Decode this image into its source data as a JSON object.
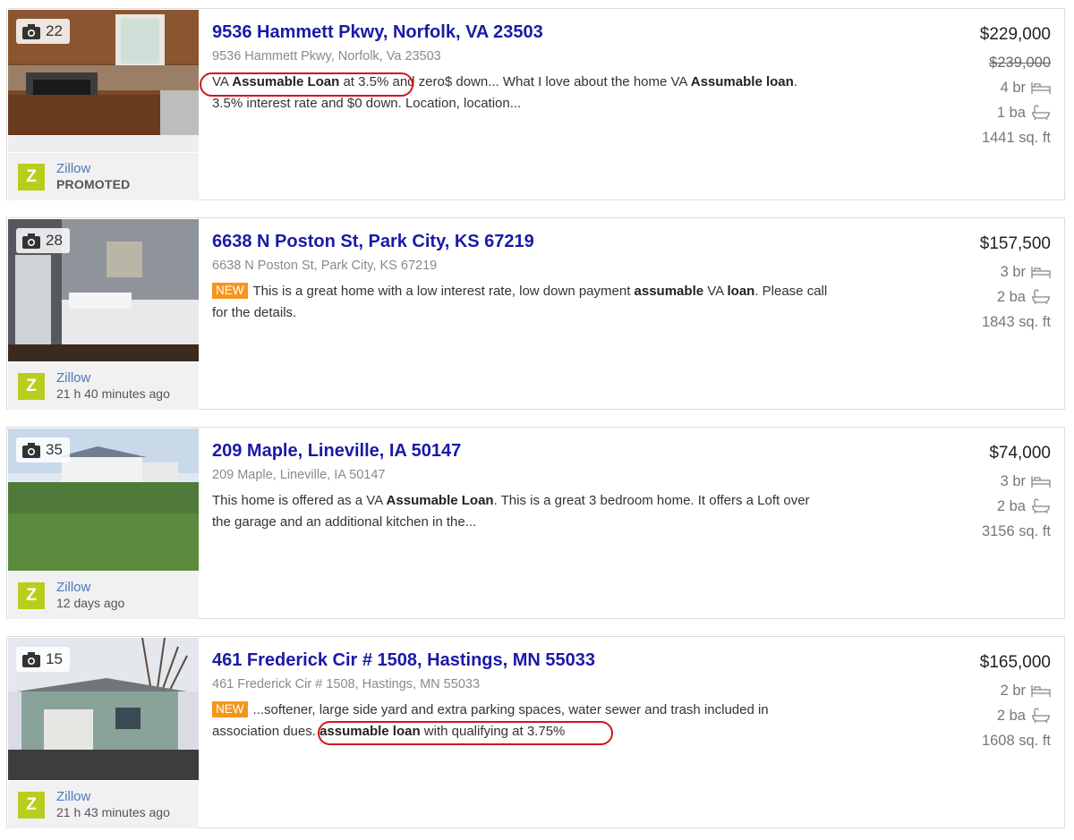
{
  "listings": [
    {
      "photo_count": "22",
      "title": "9536 Hammett Pkwy, Norfolk, VA 23503",
      "subaddress": "9536 Hammett Pkwy, Norfolk, Va 23503",
      "desc": [
        {
          "t": "VA "
        },
        {
          "b": "Assumable Loan"
        },
        {
          "t": " at 3.5% and zero$ down... What I love about the home VA "
        },
        {
          "b": "Assumable"
        },
        {
          "t": " "
        },
        {
          "b": "loan"
        },
        {
          "t": ". 3.5% interest rate and $0 down. Location, location..."
        }
      ],
      "is_new": false,
      "source_name": "Zillow",
      "source_sub": "PROMOTED",
      "price": "$229,000",
      "old_price": "$239,000",
      "beds": "4 br",
      "baths": "1 ba",
      "sqft": "1441 sq. ft"
    },
    {
      "photo_count": "28",
      "title": "6638 N Poston St, Park City, KS 67219",
      "subaddress": "6638 N Poston St, Park City, KS 67219",
      "desc": [
        {
          "t": "This is a great home with a low interest rate, low down payment "
        },
        {
          "b": "assumable"
        },
        {
          "t": " VA "
        },
        {
          "b": "loan"
        },
        {
          "t": ". Please call for the details."
        }
      ],
      "is_new": true,
      "source_name": "Zillow",
      "source_sub": "21 h 40 minutes ago",
      "price": "$157,500",
      "beds": "3 br",
      "baths": "2 ba",
      "sqft": "1843 sq. ft"
    },
    {
      "photo_count": "35",
      "title": "209 Maple, Lineville, IA 50147",
      "subaddress": "209 Maple, Lineville, IA 50147",
      "desc": [
        {
          "t": "This home is offered as a VA "
        },
        {
          "b": "Assumable Loan"
        },
        {
          "t": ". This is a great 3 bedroom home. It offers a Loft over the garage and an additional kitchen in the..."
        }
      ],
      "is_new": false,
      "source_name": "Zillow",
      "source_sub": "12 days ago",
      "price": "$74,000",
      "beds": "3 br",
      "baths": "2 ba",
      "sqft": "3156 sq. ft"
    },
    {
      "photo_count": "15",
      "title": "461 Frederick Cir # 1508, Hastings, MN 55033",
      "subaddress": "461 Frederick Cir # 1508, Hastings, MN 55033",
      "desc": [
        {
          "t": "...softener, large side yard and extra parking spaces, water sewer and trash included in association dues. "
        },
        {
          "b": "assumable loan"
        },
        {
          "t": " with qualifying at 3.75%"
        }
      ],
      "is_new": true,
      "source_name": "Zillow",
      "source_sub": "21 h 43 minutes ago",
      "price": "$165,000",
      "beds": "2 br",
      "baths": "2 ba",
      "sqft": "1608 sq. ft"
    }
  ],
  "new_label": "NEW",
  "zillow_letter": "Z",
  "colors": {
    "title": "#1a1aa6",
    "new_tag": "#f7941d",
    "zillow": "#b9cd1d",
    "highlight": "#d0161b"
  }
}
